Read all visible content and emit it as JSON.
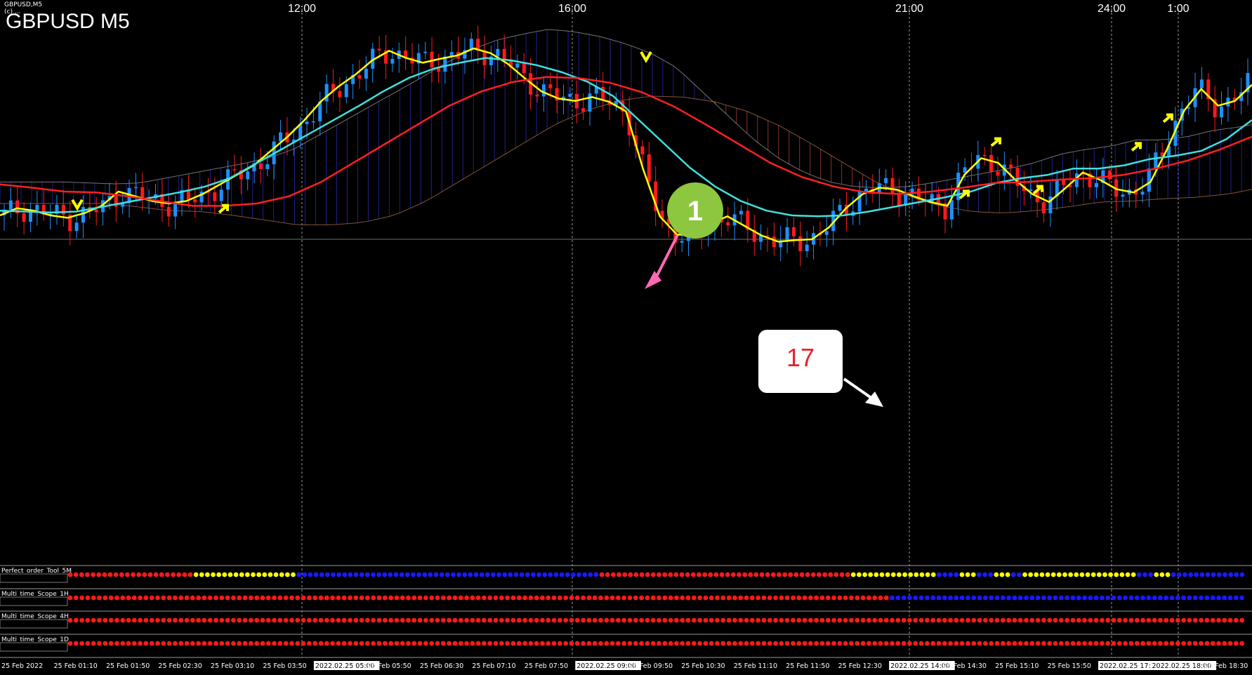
{
  "window": {
    "symbol_small": "GBPUSD,M5",
    "copyright": "(c) ...",
    "title": "GBPUSD M5"
  },
  "chart_data": {
    "type": "candlestick",
    "symbol": "GBPUSD",
    "timeframe": "M5",
    "top_time_labels": [
      "12:00",
      "16:00",
      "21:00",
      "24:00",
      "1:00"
    ],
    "bottom_time_labels": [
      "25 Feb 2022",
      "25 Feb 01:10",
      "25 Feb 01:50",
      "25 Feb 02:30",
      "25 Feb 03:10",
      "25 Feb 03:50",
      "2022.02.25 05:00",
      "25 Feb 05:50",
      "25 Feb 06:30",
      "25 Feb 07:10",
      "25 Feb 07:50",
      "2022.02.25 09:00",
      "25 Feb 09:50",
      "25 Feb 10:30",
      "25 Feb 11:10",
      "25 Feb 11:50",
      "25 Feb 12:30",
      "2022.02.25 14:00",
      "25 Feb 14:30",
      "25 Feb 15:10",
      "25 Feb 15:50",
      "2022.02.25 17:00",
      "2022.02.25 18:00",
      "25 Feb 18:30"
    ],
    "lines": [
      {
        "name": "",
        "color": "#ffff00",
        "points": [
          0.578,
          0.593,
          0.588,
          0.578,
          0.573,
          0.583,
          0.598,
          0.628,
          0.618,
          0.608,
          0.603,
          0.608,
          0.623,
          0.643,
          0.663,
          0.683,
          0.713,
          0.743,
          0.778,
          0.818,
          0.848,
          0.873,
          0.903,
          0.923,
          0.908,
          0.898,
          0.906,
          0.913,
          0.928,
          0.918,
          0.896,
          0.866,
          0.838,
          0.823,
          0.818,
          0.826,
          0.816,
          0.796,
          0.676,
          0.576,
          0.538,
          0.536,
          0.562,
          0.576,
          0.556,
          0.536,
          0.523,
          0.526,
          0.528,
          0.553,
          0.593,
          0.623,
          0.636,
          0.632,
          0.618,
          0.606,
          0.598,
          0.663,
          0.698,
          0.688,
          0.653,
          0.623,
          0.606,
          0.636,
          0.668,
          0.653,
          0.633,
          0.626,
          0.648,
          0.718,
          0.798,
          0.843,
          0.808,
          0.818,
          0.852
        ]
      },
      {
        "name": "",
        "color": "#40e0e0",
        "points": [
          0.588,
          0.586,
          0.584,
          0.586,
          0.596,
          0.606,
          0.616,
          0.626,
          0.638,
          0.656,
          0.686,
          0.716,
          0.746,
          0.776,
          0.806,
          0.838,
          0.866,
          0.886,
          0.898,
          0.908,
          0.903,
          0.893,
          0.878,
          0.858,
          0.828,
          0.778,
          0.728,
          0.678,
          0.638,
          0.608,
          0.588,
          0.578,
          0.576,
          0.578,
          0.586,
          0.596,
          0.606,
          0.616,
          0.628,
          0.646,
          0.656,
          0.663,
          0.676,
          0.676,
          0.683,
          0.696,
          0.703,
          0.713,
          0.738,
          0.778
        ]
      },
      {
        "name": "",
        "color": "#ff2020",
        "points": [
          0.643,
          0.636,
          0.628,
          0.626,
          0.618,
          0.608,
          0.598,
          0.598,
          0.603,
          0.618,
          0.648,
          0.688,
          0.728,
          0.768,
          0.808,
          0.838,
          0.858,
          0.868,
          0.866,
          0.856,
          0.836,
          0.806,
          0.768,
          0.728,
          0.688,
          0.658,
          0.638,
          0.626,
          0.623,
          0.628,
          0.636,
          0.646,
          0.648,
          0.653,
          0.656,
          0.663,
          0.676,
          0.693,
          0.716,
          0.743
        ]
      }
    ],
    "indicator_panels": [
      {
        "name": "Perfect_order_Tool_5M",
        "segments": [
          [
            "red",
            22
          ],
          [
            "yellow",
            18
          ],
          [
            "blue",
            53
          ],
          [
            "red",
            44
          ],
          [
            "yellow",
            15
          ],
          [
            "blue",
            4
          ],
          [
            "yellow",
            3
          ],
          [
            "blue",
            3
          ],
          [
            "yellow",
            3
          ],
          [
            "blue",
            2
          ],
          [
            "yellow",
            20
          ],
          [
            "blue",
            3
          ],
          [
            "yellow",
            3
          ],
          [
            "blue",
            13
          ]
        ]
      },
      {
        "name": "Multi_time_Scope_1H",
        "segments": [
          [
            "red",
            141
          ],
          [
            "blue",
            61
          ]
        ]
      },
      {
        "name": "Multi_time_Scope_4H",
        "segments": [
          [
            "red",
            202
          ]
        ]
      },
      {
        "name": "Multi_time_Scope_1D",
        "segments": [
          [
            "red",
            202
          ]
        ]
      }
    ],
    "annotations": [
      {
        "label": "1",
        "type": "green-circle"
      },
      {
        "label": "17",
        "type": "white-box"
      }
    ],
    "grid": true
  },
  "colors": {
    "background": "#000000",
    "bull": "#1e90ff",
    "bear": "#ff1a1a",
    "signal_arrow": "#ffff00",
    "annotation_green": "#8dc63f",
    "annotation_pink": "#ff69b4",
    "annotation_red_text": "#e8202a"
  }
}
